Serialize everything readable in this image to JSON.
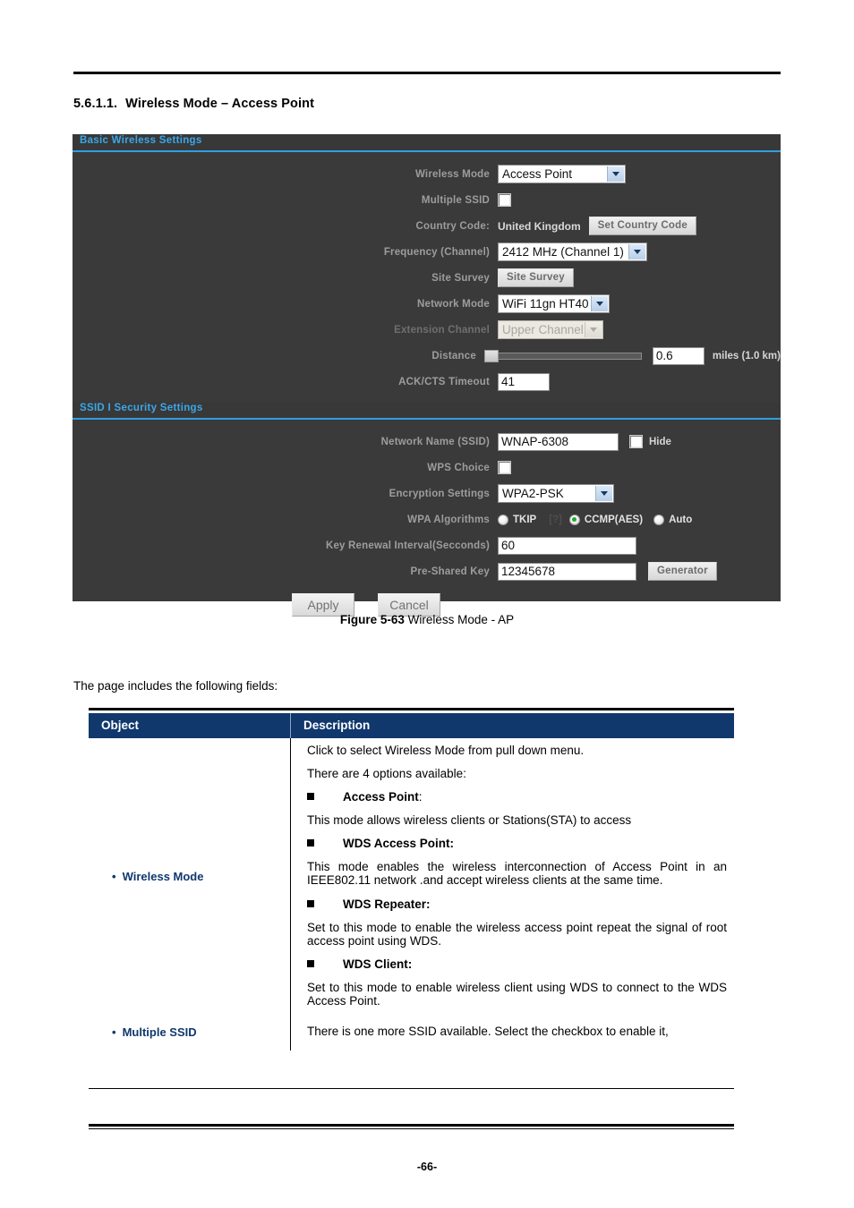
{
  "document": {
    "heading_number": "5.6.1.1.",
    "heading_title": "Wireless Mode – Access Point",
    "intro_text": "The page includes the following fields:",
    "figure_label": "Figure 5-63",
    "figure_title": "Wireless Mode - AP",
    "page_number": "-66-"
  },
  "device_panel": {
    "basic_section_title": "Basic Wireless Settings",
    "security_section_title": "SSID I Security Settings",
    "basic_rows": {
      "wireless_mode_label": "Wireless Mode",
      "wireless_mode_value": "Access Point",
      "multiple_ssid_label": "Multiple SSID",
      "country_code_label": "Country Code:",
      "country_code_value": "United Kingdom",
      "set_country_code_button": "Set Country Code",
      "frequency_label": "Frequency (Channel)",
      "frequency_value": "2412 MHz (Channel 1)",
      "site_survey_label": "Site Survey",
      "site_survey_button": "Site Survey",
      "network_mode_label": "Network Mode",
      "network_mode_value": "WiFi 11gn HT40",
      "extension_channel_label": "Extension Channel",
      "extension_channel_value": "Upper Channel",
      "distance_label": "Distance",
      "distance_value": "0.6",
      "distance_unit": "miles (1.0 km)",
      "ack_cts_label": "ACK/CTS Timeout",
      "ack_cts_value": "41"
    },
    "security_rows": {
      "ssid_label": "Network Name (SSID)",
      "ssid_value": "WNAP-6308",
      "hide_label": "Hide",
      "wps_choice_label": "WPS Choice",
      "encryption_label": "Encryption Settings",
      "encryption_value": "WPA2-PSK",
      "wpa_algorithms_label": "WPA Algorithms",
      "wpa_option_tkip": "TKIP",
      "wpa_help_glyph": "[?]",
      "wpa_option_ccmp": "CCMP(AES)",
      "wpa_option_auto": "Auto",
      "key_renewal_label": "Key Renewal Interval(Secconds)",
      "key_renewal_value": "60",
      "psk_label": "Pre-Shared Key",
      "psk_value": "12345678",
      "generator_button": "Generator"
    },
    "buttons": {
      "apply": "Apply",
      "cancel": "Cancel"
    },
    "colors": {
      "panel_background": "#3a3a3a",
      "section_title": "#3ba7e8",
      "section_underline": "#2e9fe0",
      "label_text": "#9d9d9d",
      "radio_selected": "#1faa2a"
    }
  },
  "spec_table": {
    "headers": {
      "object": "Object",
      "description": "Description"
    },
    "rows": [
      {
        "object": "Wireless Mode",
        "description_blocks": [
          {
            "kind": "text",
            "text": "Click to select Wireless Mode from pull down menu."
          },
          {
            "kind": "text",
            "text": "There are 4 options available:"
          },
          {
            "kind": "bullet",
            "text": "Access Point",
            "suffix": ":"
          },
          {
            "kind": "text",
            "text": "This mode allows wireless clients or Stations(STA) to access"
          },
          {
            "kind": "bullet",
            "text": "WDS Access Point:",
            "suffix": ""
          },
          {
            "kind": "text",
            "text": "This mode enables the wireless interconnection of Access Point in an IEEE802.11 network .and accept wireless clients at the same time."
          },
          {
            "kind": "bullet",
            "text": "WDS Repeater:",
            "suffix": ""
          },
          {
            "kind": "text",
            "text": "Set to this mode to enable the wireless access point repeat the signal of root access point using WDS."
          },
          {
            "kind": "bullet",
            "text": "WDS Client:",
            "suffix": ""
          },
          {
            "kind": "text",
            "text": "Set to this mode to enable wireless client using WDS to connect to the WDS Access Point."
          }
        ]
      },
      {
        "object": "Multiple SSID",
        "description_blocks": [
          {
            "kind": "text",
            "text": "There is one more SSID available. Select the checkbox to enable it,"
          }
        ]
      }
    ],
    "colors": {
      "header_background": "#10386d",
      "object_text": "#10386d"
    }
  }
}
